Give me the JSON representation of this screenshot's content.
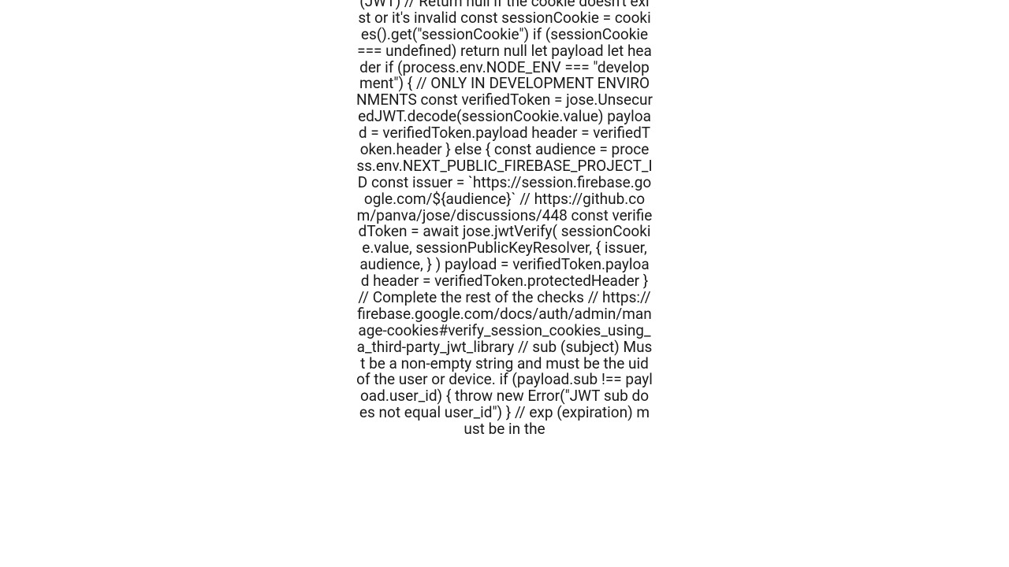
{
  "code_text": "(JWT)    // Return null if the cookie doesn't exist or it's invalid   const sessionCookie = cookies().get(\"sessionCookie\")   if (sessionCookie === undefined) return null    let payload   let header    if (process.env.NODE_ENV === \"development\") {     // ONLY IN DEVELOPMENT ENVIRONMENTS     const verifiedToken = jose.UnsecuredJWT.decode(sessionCookie.value)     payload = verifiedToken.payload     header = verifiedToken.header   } else {     const audience = process.env.NEXT_PUBLIC_FIREBASE_PROJECT_ID     const issuer = `https://session.firebase.google.com/${audience}`      // https://github.com/panva/jose/discussions/448     const verifiedToken = await jose.jwtVerify(       sessionCookie.value,       sessionPublicKeyResolver,       {         issuer,         audience,       }     )     payload = verifiedToken.payload     header = verifiedToken.protectedHeader   }    // Complete the rest of the checks   // https://firebase.google.com/docs/auth/admin/manage-cookies#verify_session_cookies_using_a_third-party_jwt_library    // sub (subject) Must be a non-empty string and must be the uid of the user or device.   if (payload.sub !== payload.user_id) {     throw new Error(\"JWT sub does not equal user_id\")   }    // exp (expiration) must be in the"
}
